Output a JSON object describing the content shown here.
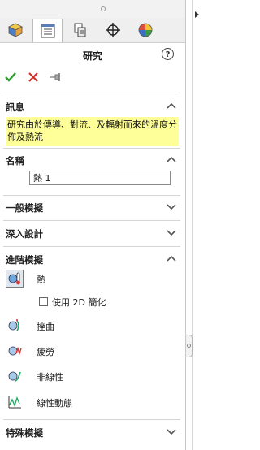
{
  "tabs": [
    {
      "icon": "feature-manager-icon"
    },
    {
      "icon": "property-manager-icon"
    },
    {
      "icon": "configuration-manager-icon"
    },
    {
      "icon": "dimxpert-icon"
    },
    {
      "icon": "display-manager-icon"
    }
  ],
  "header": {
    "title": "研究",
    "help_label": "?"
  },
  "actions": {
    "ok": "check-icon",
    "cancel": "close-icon",
    "pin": "pin-icon"
  },
  "sections": {
    "message": {
      "label": "訊息",
      "text": "研究由於傳導、對流、及輻射而來的溫度分佈及熱流"
    },
    "name": {
      "label": "名稱",
      "value": "熱 1"
    },
    "general": {
      "label": "一般模擬"
    },
    "design_insight": {
      "label": "深入設計"
    },
    "advanced": {
      "label": "進階模擬",
      "items": [
        {
          "label": "熱",
          "icon": "thermal-study-icon",
          "selected": true
        },
        {
          "label": "挫曲",
          "icon": "buckling-study-icon"
        },
        {
          "label": "疲勞",
          "icon": "fatigue-study-icon"
        },
        {
          "label": "非線性",
          "icon": "nonlinear-study-icon"
        },
        {
          "label": "線性動態",
          "icon": "linear-dynamic-study-icon"
        }
      ],
      "simplify_label": "使用 2D 簡化"
    },
    "specialized": {
      "label": "特殊模擬"
    }
  }
}
